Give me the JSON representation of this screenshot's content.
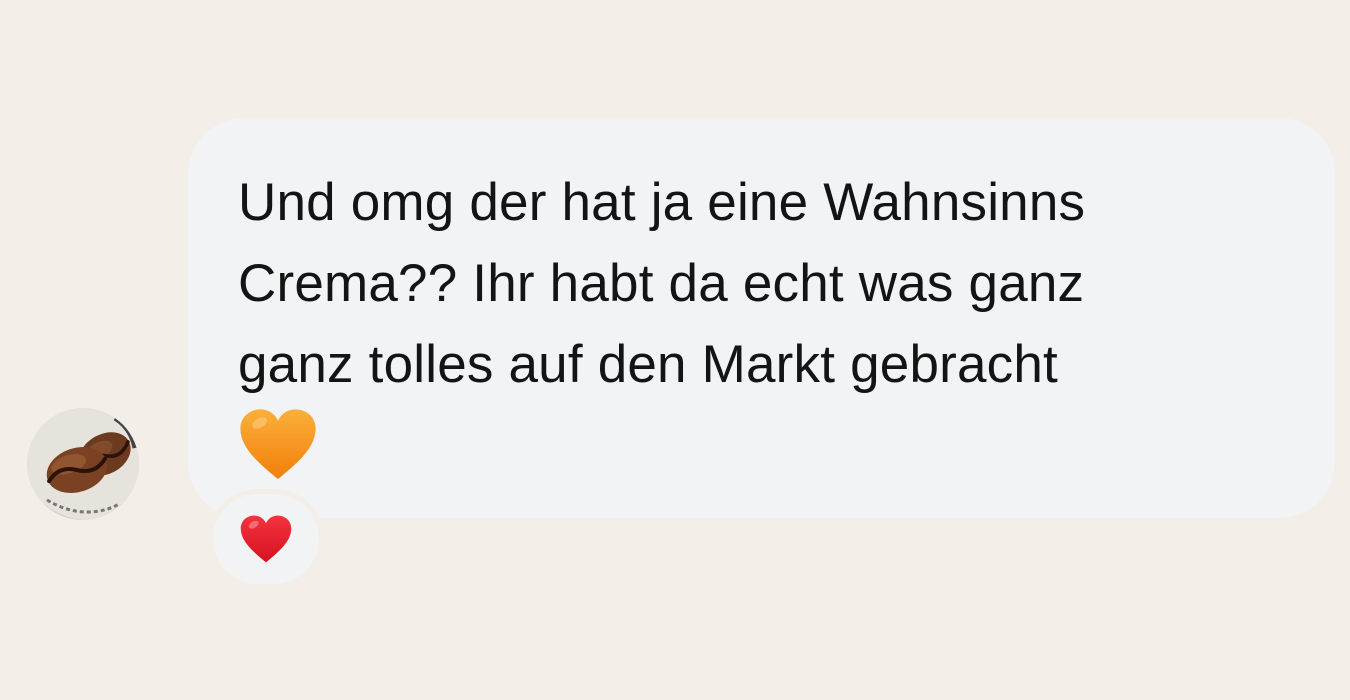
{
  "message": {
    "text": "Und omg der hat ja eine Wahnsinns\nCrema?? Ihr habt da echt was ganz\nganz tolles auf den Markt gebracht",
    "trailing_emoji": "orange-heart-emoji"
  },
  "sender": {
    "avatar_icon": "coffee-beans-avatar-icon"
  },
  "reaction": {
    "emoji": "red-heart-emoji"
  },
  "colors": {
    "background": "#f3efe8",
    "bubble": "#f1f3f5",
    "text": "#141414",
    "orange_heart": "#f79a1e",
    "red_heart": "#e8202f"
  }
}
